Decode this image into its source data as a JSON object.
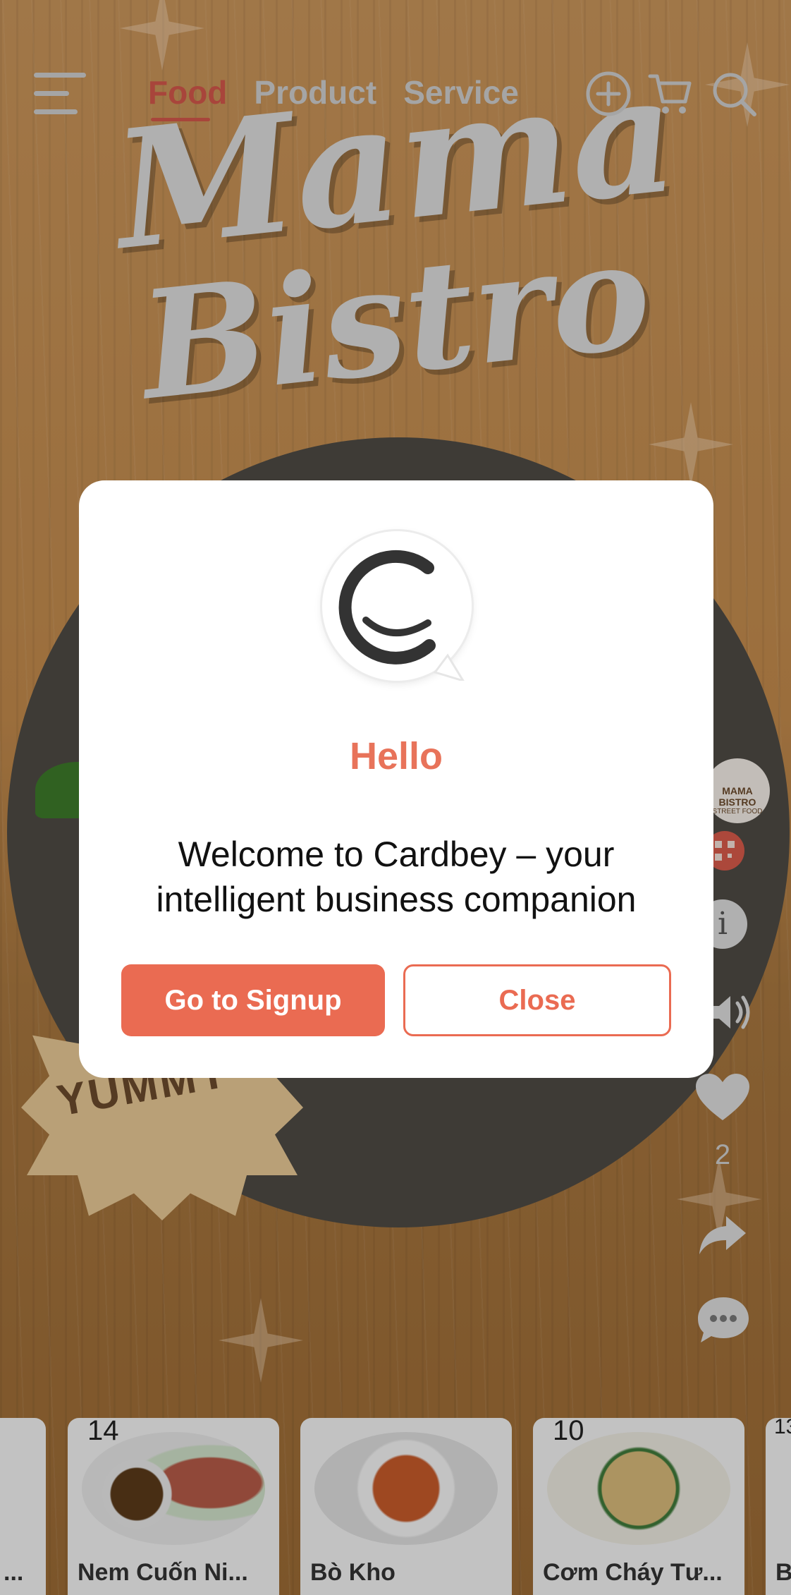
{
  "header": {
    "tabs": [
      {
        "label": "Food",
        "active": true
      },
      {
        "label": "Product",
        "active": false
      },
      {
        "label": "Service",
        "active": false
      }
    ],
    "icons": [
      "menu-icon",
      "add-icon",
      "cart-icon",
      "search-icon"
    ]
  },
  "background": {
    "brand_line1": "Mama",
    "brand_line2": "Bistro",
    "badge": "YUMMY"
  },
  "rail": {
    "logo_text": "MAMA BISTRO",
    "logo_subtext": "STREET FOOD",
    "info_label": "i",
    "like_count": "2"
  },
  "carousel": {
    "items": [
      {
        "number": "",
        "label": "..."
      },
      {
        "number": "14",
        "label": "Nem Cuốn Ni..."
      },
      {
        "number": "",
        "label": "Bò Kho"
      },
      {
        "number": "10",
        "label": "Cơm Cháy Tư..."
      },
      {
        "number": "13",
        "label": "B"
      }
    ]
  },
  "modal": {
    "title": "Hello",
    "message": "Welcome to Cardbey – your intelligent business companion",
    "primary_button": "Go to Signup",
    "secondary_button": "Close"
  },
  "colors": {
    "accent": "#ea6b52",
    "active_tab": "#d2574a"
  }
}
